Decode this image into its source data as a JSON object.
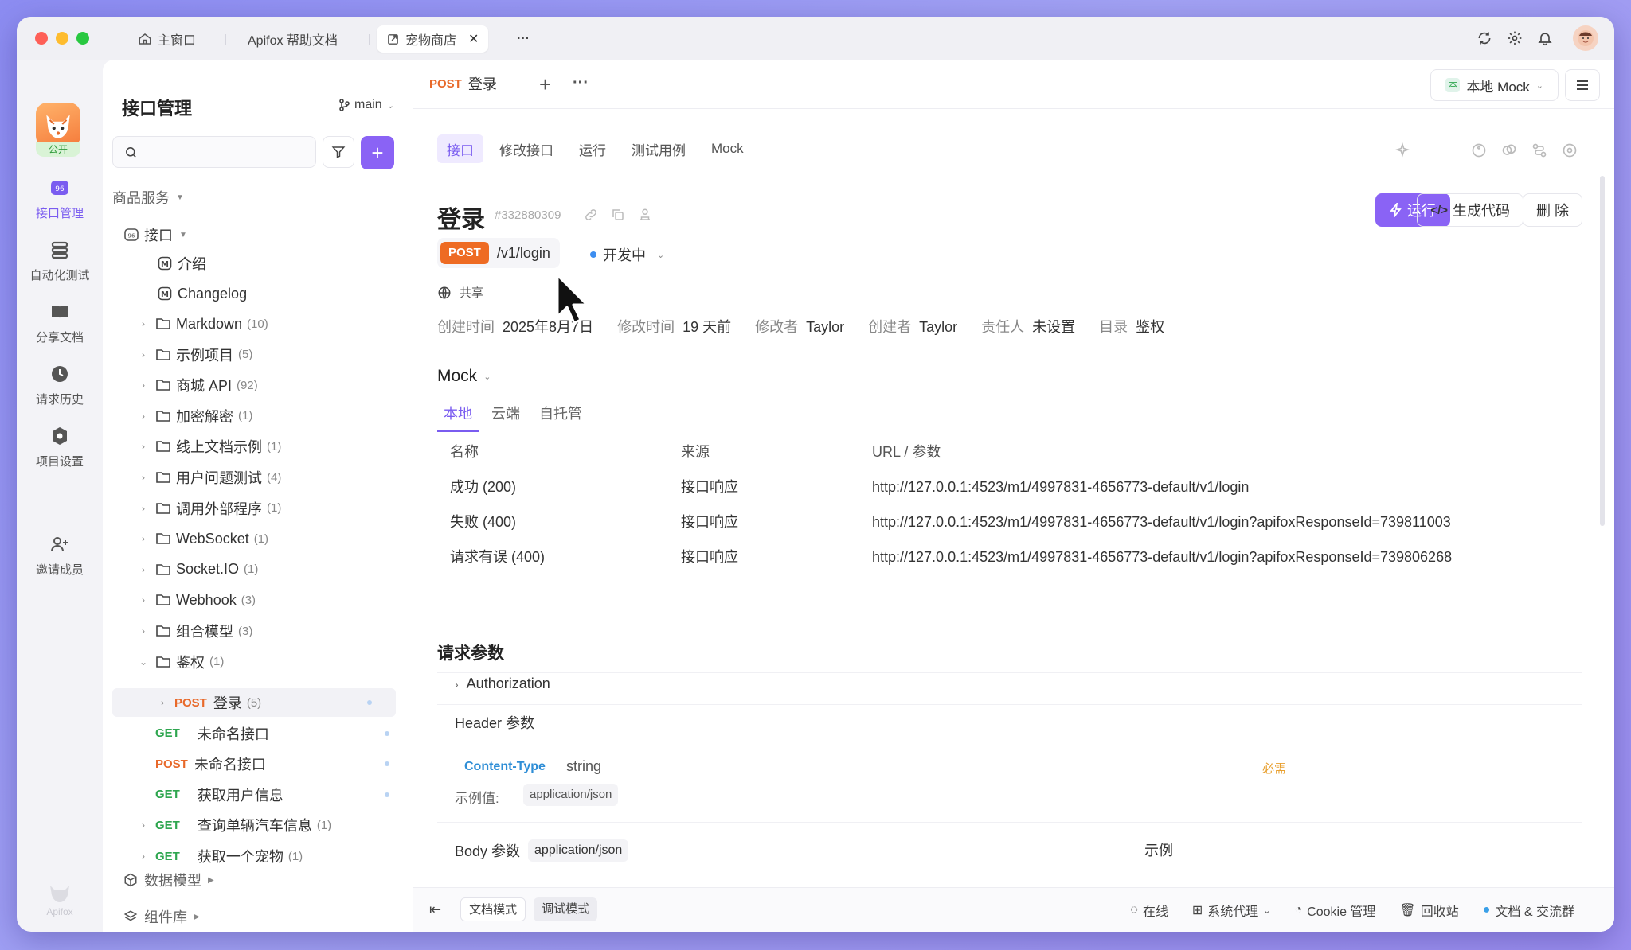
{
  "window": {
    "tabs": [
      {
        "label": "主窗口"
      },
      {
        "label": "Apifox 帮助文档"
      },
      {
        "label": "宠物商店",
        "close": "✕"
      }
    ],
    "more": "···"
  },
  "rail": {
    "badge": "公开",
    "items": [
      {
        "label": "接口管理",
        "icon": "api-icon"
      },
      {
        "label": "自动化测试",
        "icon": "automation-icon"
      },
      {
        "label": "分享文档",
        "icon": "book-icon"
      },
      {
        "label": "请求历史",
        "icon": "clock-icon"
      },
      {
        "label": "项目设置",
        "icon": "settings-icon"
      },
      {
        "label": "邀请成员",
        "icon": "invite-icon"
      }
    ],
    "footer": "Apifox"
  },
  "sidebar": {
    "title": "接口管理",
    "branch": "main",
    "search_placeholder": "",
    "group1": "商品服务",
    "root": "接口",
    "docs": [
      {
        "label": "介绍"
      },
      {
        "label": "Changelog"
      }
    ],
    "folders": [
      {
        "label": "Markdown",
        "count": "(10)"
      },
      {
        "label": "示例项目",
        "count": "(5)"
      },
      {
        "label": "商城 API",
        "count": "(92)"
      },
      {
        "label": "加密解密",
        "count": "(1)"
      },
      {
        "label": "线上文档示例",
        "count": "(1)"
      },
      {
        "label": "用户问题测试",
        "count": "(4)"
      },
      {
        "label": "调用外部程序",
        "count": "(1)"
      },
      {
        "label": "WebSocket",
        "count": "(1)"
      },
      {
        "label": "Socket.IO",
        "count": "(1)"
      },
      {
        "label": "Webhook",
        "count": "(3)"
      },
      {
        "label": "组合模型",
        "count": "(3)"
      },
      {
        "label": "鉴权",
        "count": "(1)"
      }
    ],
    "endpoints": [
      {
        "method": "POST",
        "label": "登录",
        "count": "(5)"
      },
      {
        "method": "GET",
        "label": "未命名接口",
        "count": ""
      },
      {
        "method": "POST",
        "label": "未命名接口",
        "count": ""
      },
      {
        "method": "GET",
        "label": "获取用户信息",
        "count": ""
      },
      {
        "method": "GET",
        "label": "查询单辆汽车信息",
        "count": "(1)"
      },
      {
        "method": "GET",
        "label": "获取一个宠物",
        "count": "(1)"
      }
    ],
    "group2": "数据模型",
    "group3": "组件库"
  },
  "main": {
    "tab": {
      "method": "POST",
      "label": "登录"
    },
    "mock_select": "本地 Mock",
    "subtabs": [
      "接口",
      "修改接口",
      "运行",
      "测试用例",
      "Mock"
    ],
    "title": "登录",
    "id": "#332880309",
    "actions": {
      "run": "运行",
      "code": "生成代码",
      "delete": "删 除"
    },
    "method": "POST",
    "path": "/v1/login",
    "status": "开发中",
    "share": "共享",
    "meta": [
      {
        "k": "创建时间",
        "v": "2025年8月7日"
      },
      {
        "k": "修改时间",
        "v": "19 天前"
      },
      {
        "k": "修改者",
        "v": "Taylor"
      },
      {
        "k": "创建者",
        "v": "Taylor"
      },
      {
        "k": "责任人",
        "v": "未设置"
      },
      {
        "k": "目录",
        "v": "鉴权"
      }
    ],
    "mock": {
      "title": "Mock",
      "tabs": [
        "本地",
        "云端",
        "自托管"
      ],
      "columns": [
        "名称",
        "来源",
        "URL / 参数"
      ],
      "rows": [
        {
          "name": "成功 (200)",
          "source": "接口响应",
          "url": "http://127.0.0.1:4523/m1/4997831-4656773-default/v1/login"
        },
        {
          "name": "失败 (400)",
          "source": "接口响应",
          "url": "http://127.0.0.1:4523/m1/4997831-4656773-default/v1/login?apifoxResponseId=739811003"
        },
        {
          "name": "请求有误 (400)",
          "source": "接口响应",
          "url": "http://127.0.0.1:4523/m1/4997831-4656773-default/v1/login?apifoxResponseId=739806268"
        }
      ]
    },
    "request": {
      "title": "请求参数",
      "auth": "Authorization",
      "header_title": "Header 参数",
      "param": {
        "name": "Content-Type",
        "type": "string",
        "required": "必需",
        "example_label": "示例值:",
        "example": "application/json"
      },
      "body_title": "Body 参数",
      "body_type": "application/json",
      "example_title": "示例"
    }
  },
  "bottom": {
    "doc_mode": "文档模式",
    "debug_mode": "调试模式",
    "online": "在线",
    "proxy": "系统代理",
    "cookie": "Cookie 管理",
    "trash": "回收站",
    "community": "文档 & 交流群"
  }
}
